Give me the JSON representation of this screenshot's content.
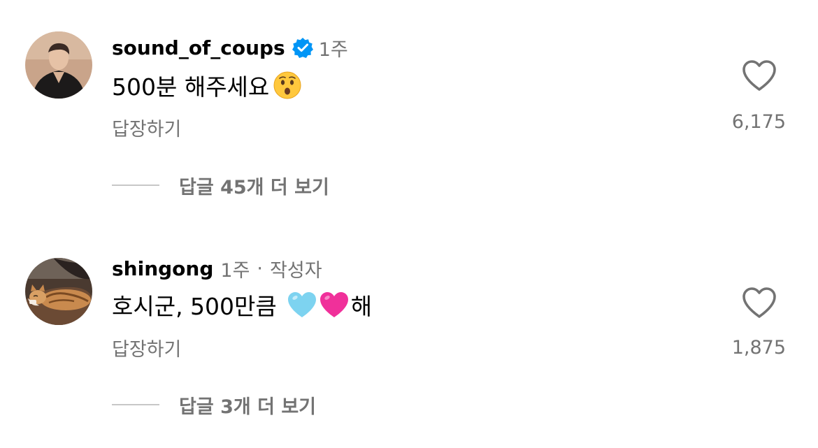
{
  "comments": [
    {
      "username": "sound_of_coups",
      "verified": true,
      "time": "1주",
      "text": "500분 해주세요",
      "emojis": [
        "hushed-face-emoji"
      ],
      "reply_label": "답장하기",
      "likes": "6,175",
      "view_replies": "답글 45개 더 보기"
    },
    {
      "username": "shingong",
      "verified": false,
      "time": "1주",
      "separator": "·",
      "author_tag": "작성자",
      "text": "호시군, 500만큼",
      "text_suffix": "해",
      "emojis": [
        "light-blue-heart-emoji",
        "pink-heart-emoji"
      ],
      "reply_label": "답장하기",
      "likes": "1,875",
      "view_replies": "답글 3개 더 보기"
    }
  ],
  "colors": {
    "secondary_text": "#737373",
    "verified_blue": "#0095F6",
    "divider": "#c7c7c7"
  },
  "icons": {
    "like": "heart-outline-icon",
    "verified": "verified-badge-icon"
  }
}
